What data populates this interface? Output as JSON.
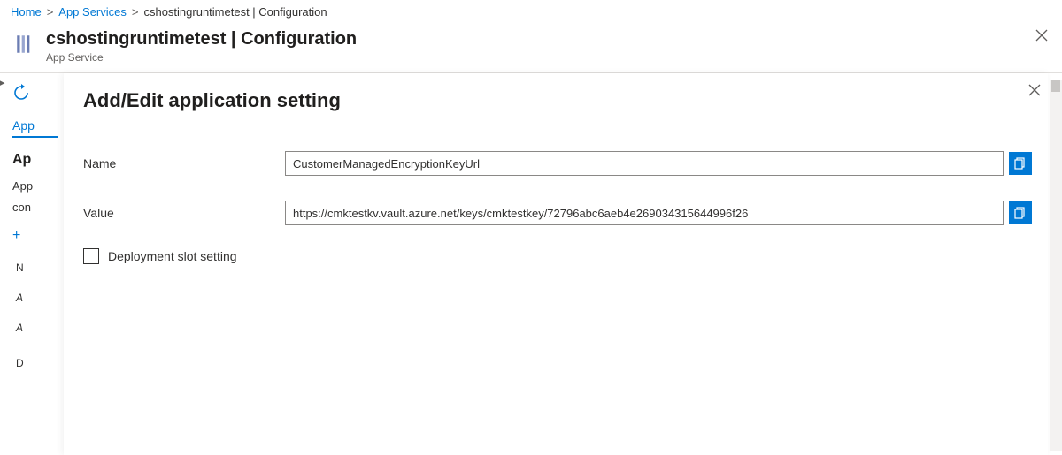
{
  "breadcrumb": {
    "home": "Home",
    "appservices": "App Services",
    "current": "cshostingruntimetest | Configuration"
  },
  "header": {
    "title": "cshostingruntimetest | Configuration",
    "subtitle": "App Service"
  },
  "leftnav": {
    "tab_active": "App",
    "heading": "Ap",
    "text1": "App",
    "text2": "con",
    "col_header": "N",
    "row_a1": "A",
    "row_a2": "A",
    "row_d": "D"
  },
  "flyout": {
    "title": "Add/Edit application setting",
    "name_label": "Name",
    "name_value": "CustomerManagedEncryptionKeyUrl",
    "value_label": "Value",
    "value_value": "https://cmktestkv.vault.azure.net/keys/cmktestkey/72796abc6aeb4e269034315644996f26",
    "checkbox_label": "Deployment slot setting"
  }
}
